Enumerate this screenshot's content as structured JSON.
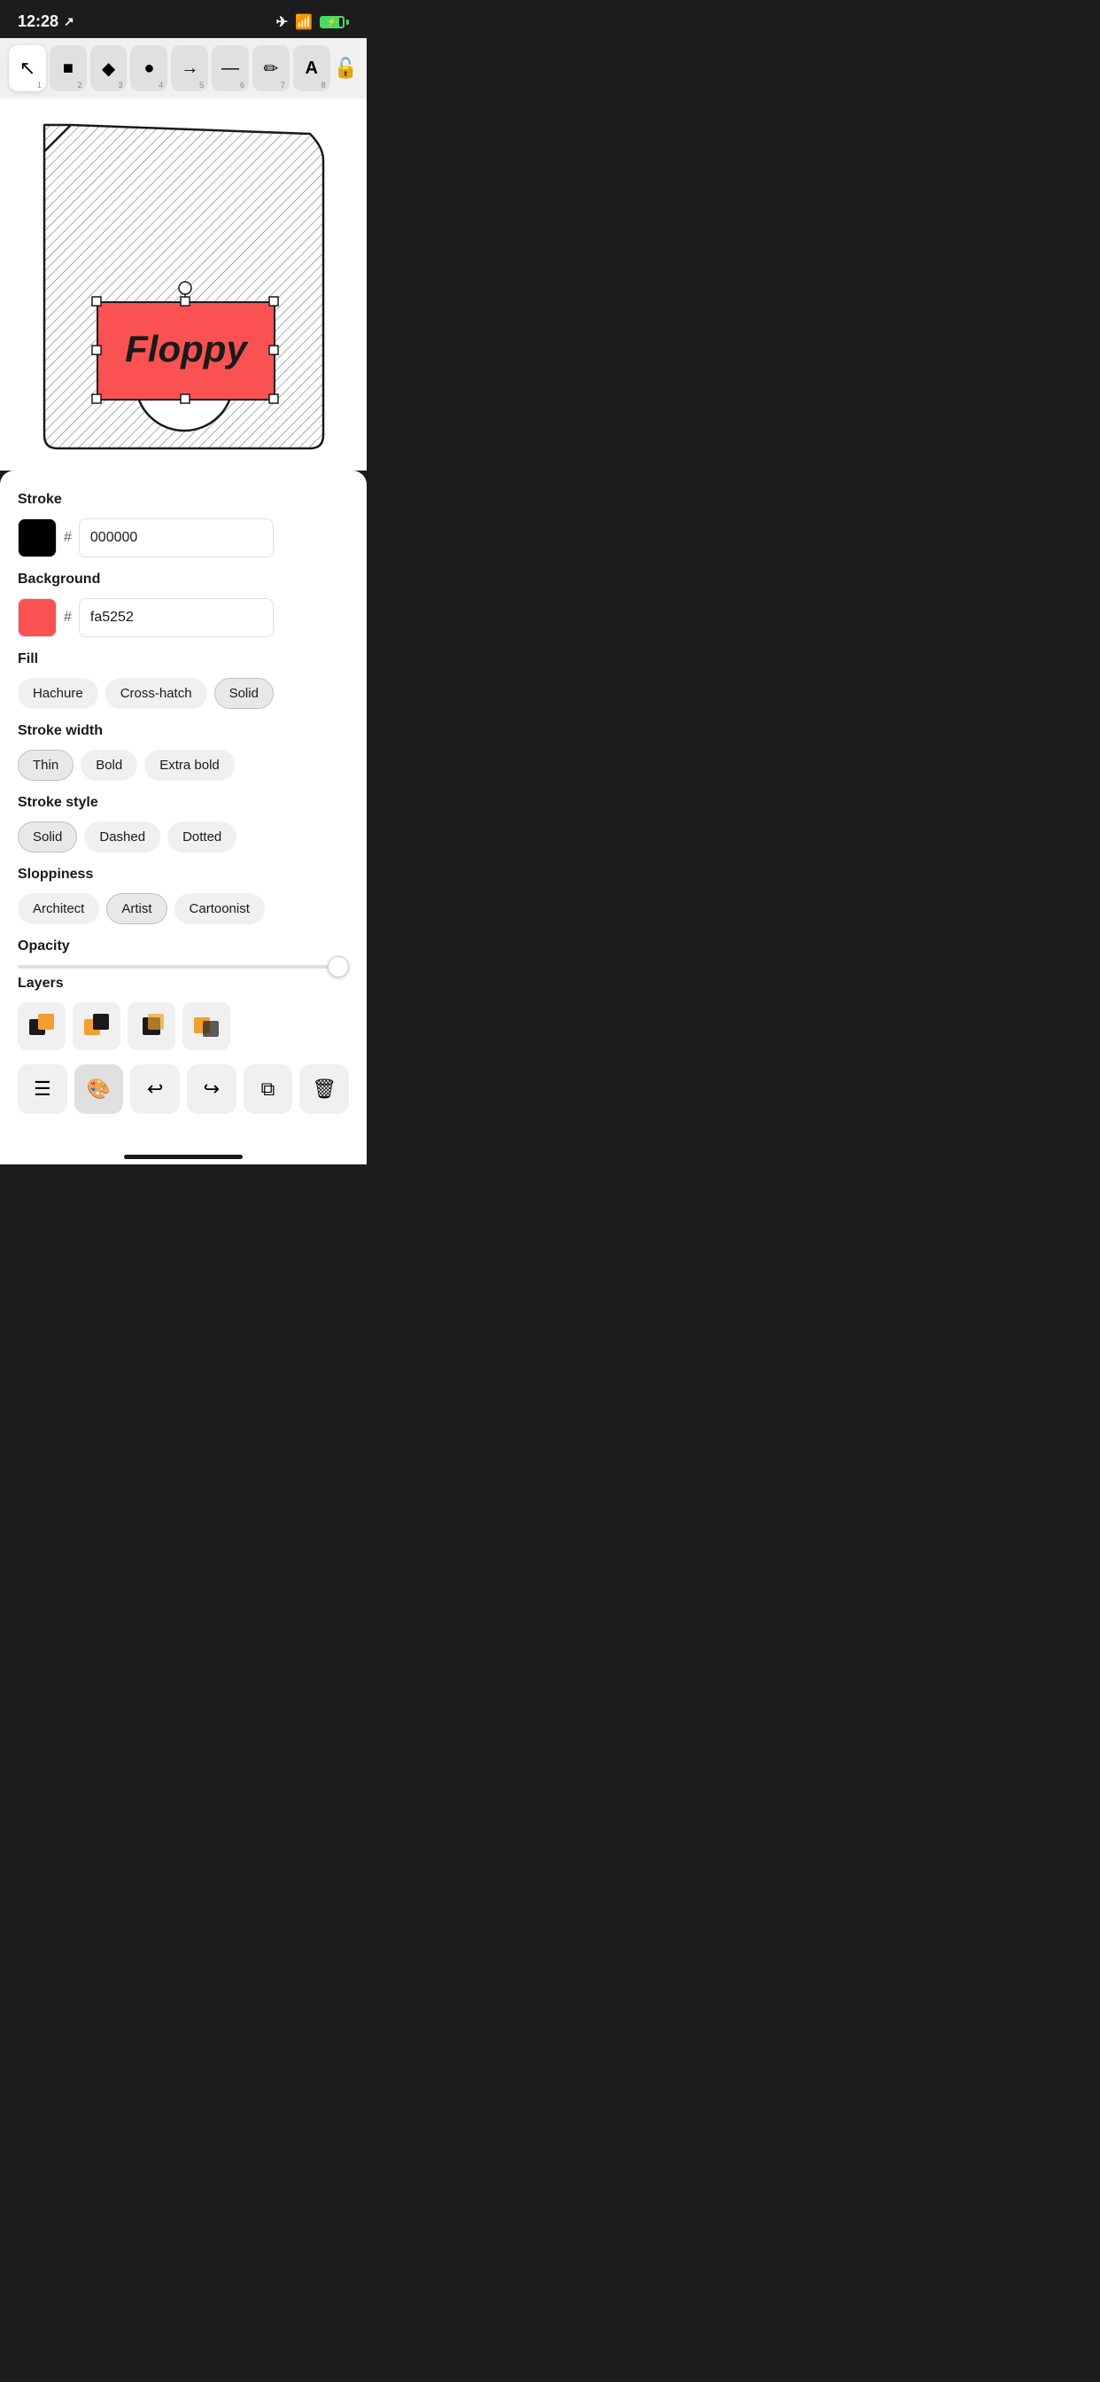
{
  "statusBar": {
    "time": "12:28",
    "airplane": true,
    "wifi": true,
    "battery": "charging"
  },
  "toolbar": {
    "tools": [
      {
        "id": "select",
        "label": "↖",
        "num": "1",
        "active": false
      },
      {
        "id": "rect",
        "label": "■",
        "num": "2",
        "active": false
      },
      {
        "id": "diamond",
        "label": "◆",
        "num": "3",
        "active": false
      },
      {
        "id": "circle",
        "label": "●",
        "num": "4",
        "active": false
      },
      {
        "id": "arrow",
        "label": "→",
        "num": "5",
        "active": false
      },
      {
        "id": "line",
        "label": "—",
        "num": "6",
        "active": false
      },
      {
        "id": "pencil",
        "label": "✏",
        "num": "7",
        "active": false
      },
      {
        "id": "text",
        "label": "A",
        "num": "8",
        "active": true
      }
    ],
    "lock": "🔓"
  },
  "panel": {
    "stroke": {
      "label": "Stroke",
      "color": "#000000",
      "hex": "000000"
    },
    "background": {
      "label": "Background",
      "color": "#fa5252",
      "hex": "fa5252"
    },
    "fill": {
      "label": "Fill",
      "options": [
        {
          "id": "hachure",
          "label": "Hachure",
          "active": false
        },
        {
          "id": "crosshatch",
          "label": "Cross-hatch",
          "active": false
        },
        {
          "id": "solid",
          "label": "Solid",
          "active": true
        }
      ]
    },
    "strokeWidth": {
      "label": "Stroke width",
      "options": [
        {
          "id": "thin",
          "label": "Thin",
          "active": true
        },
        {
          "id": "bold",
          "label": "Bold",
          "active": false
        },
        {
          "id": "extrabold",
          "label": "Extra bold",
          "active": false
        }
      ]
    },
    "strokeStyle": {
      "label": "Stroke style",
      "options": [
        {
          "id": "solid",
          "label": "Solid",
          "active": true
        },
        {
          "id": "dashed",
          "label": "Dashed",
          "active": false
        },
        {
          "id": "dotted",
          "label": "Dotted",
          "active": false
        }
      ]
    },
    "sloppiness": {
      "label": "Sloppiness",
      "options": [
        {
          "id": "architect",
          "label": "Architect",
          "active": false
        },
        {
          "id": "artist",
          "label": "Artist",
          "active": true
        },
        {
          "id": "cartoonist",
          "label": "Cartoonist",
          "active": false
        }
      ]
    },
    "opacity": {
      "label": "Opacity",
      "value": 100
    },
    "layers": {
      "label": "Layers",
      "icons": [
        "⬛🟧",
        "🟧⬛",
        "⬛🟧",
        "🟧⬛"
      ]
    }
  },
  "actionBar": {
    "buttons": [
      {
        "id": "menu",
        "label": "☰"
      },
      {
        "id": "style",
        "label": "🎨"
      },
      {
        "id": "undo",
        "label": "↩"
      },
      {
        "id": "redo",
        "label": "↪"
      },
      {
        "id": "copy",
        "label": "⧉"
      },
      {
        "id": "delete",
        "label": "🗑"
      }
    ]
  }
}
